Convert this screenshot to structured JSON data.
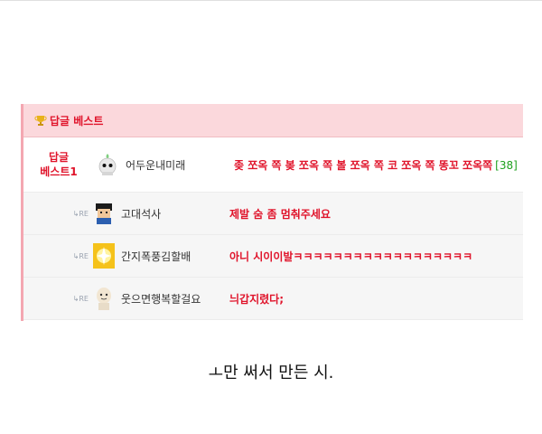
{
  "header": {
    "title": "답글 베스트",
    "icon": "trophy-icon"
  },
  "best": {
    "label_line1": "답글",
    "label_line2": "베스트1",
    "nickname": "어두운내미래",
    "comment": "좆 쪼옥 쪽 봊 쪼옥 쪽 볼 쪼옥 쪽 코 쪼옥 쪽 똥꼬 쪼옥쪽",
    "count": "[38]"
  },
  "replies": [
    {
      "tag": "RE",
      "nickname": "고대석사",
      "comment": "제발 숨 좀 멈춰주세요"
    },
    {
      "tag": "RE",
      "nickname": "간지폭풍김할배",
      "comment": "아니 시이이발ㅋㅋㅋㅋㅋㅋㅋㅋㅋㅋㅋㅋㅋㅋㅋㅋㅋㅋ"
    },
    {
      "tag": "RE",
      "nickname": "웃으면행복할걸요",
      "comment": "늬갑지렸다;"
    }
  ],
  "caption": "ㅗ만 써서 만든 시.",
  "colors": {
    "accent": "#e0142b",
    "header_bg": "#fbd8dc",
    "count": "#1ea01e",
    "border": "#f4a7b1"
  }
}
